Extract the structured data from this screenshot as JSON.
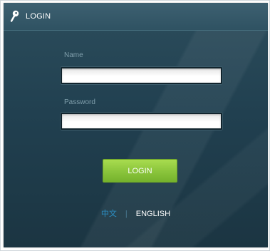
{
  "header": {
    "title": "LOGIN",
    "icon": "key-icon"
  },
  "form": {
    "name_label": "Name",
    "name_value": "",
    "password_label": "Password",
    "password_value": "",
    "submit_label": "LOGIN"
  },
  "language": {
    "chinese": "中文",
    "separator": "|",
    "english": "ENGLISH",
    "selected": "ENGLISH"
  },
  "colors": {
    "panel": "#214050",
    "header": "#2f5262",
    "button": "#8cc63d",
    "link_inactive": "#2b8fc4",
    "link_active": "#ffffff"
  }
}
